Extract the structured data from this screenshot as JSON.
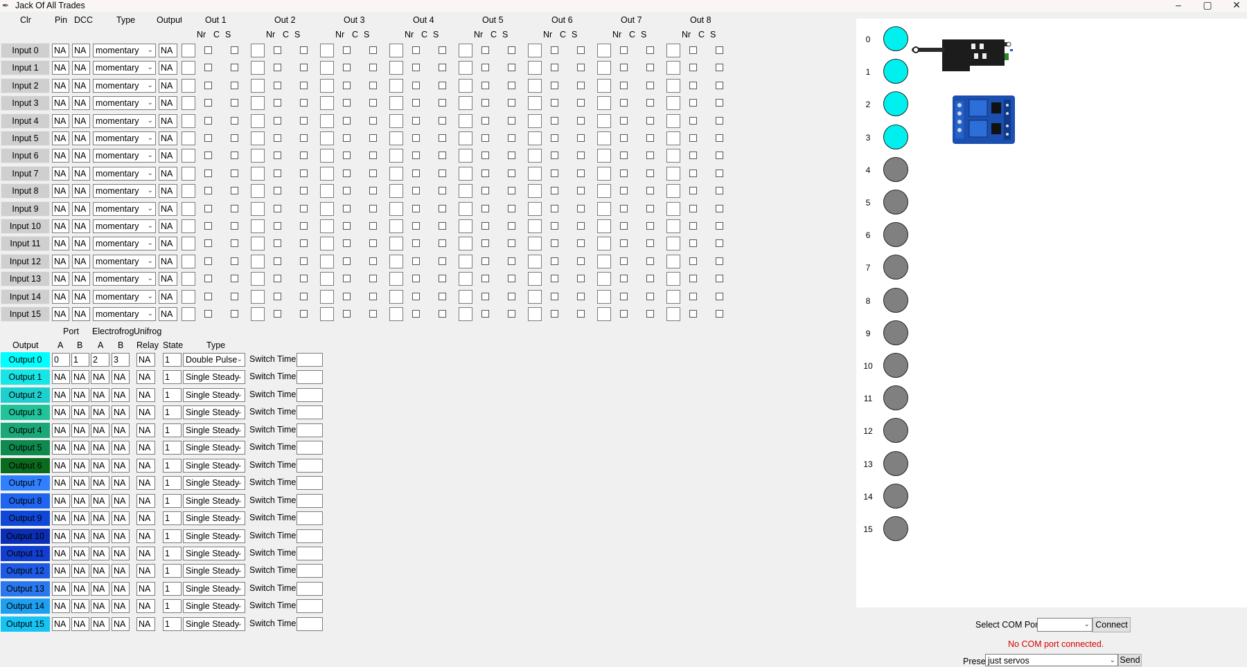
{
  "window": {
    "title": "Jack Of All Trades",
    "icon": "feather-icon",
    "minimize": "–",
    "maximize": "▢",
    "close": "✕"
  },
  "inputs_header": {
    "clr": "Clr",
    "pin": "Pin",
    "dcc": "DCC",
    "type": "Type",
    "output": "Output",
    "outs": [
      "Out 1",
      "Out 2",
      "Out 3",
      "Out 4",
      "Out 5",
      "Out 6",
      "Out 7",
      "Out 8"
    ],
    "sub": [
      "Nr",
      "C",
      "S"
    ]
  },
  "inputs": [
    {
      "label": "Input 0",
      "pin": "NA",
      "dcc": "NA",
      "type": "momentary",
      "output": "NA"
    },
    {
      "label": "Input 1",
      "pin": "NA",
      "dcc": "NA",
      "type": "momentary",
      "output": "NA"
    },
    {
      "label": "Input 2",
      "pin": "NA",
      "dcc": "NA",
      "type": "momentary",
      "output": "NA"
    },
    {
      "label": "Input 3",
      "pin": "NA",
      "dcc": "NA",
      "type": "momentary",
      "output": "NA"
    },
    {
      "label": "Input 4",
      "pin": "NA",
      "dcc": "NA",
      "type": "momentary",
      "output": "NA"
    },
    {
      "label": "Input 5",
      "pin": "NA",
      "dcc": "NA",
      "type": "momentary",
      "output": "NA"
    },
    {
      "label": "Input 6",
      "pin": "NA",
      "dcc": "NA",
      "type": "momentary",
      "output": "NA"
    },
    {
      "label": "Input 7",
      "pin": "NA",
      "dcc": "NA",
      "type": "momentary",
      "output": "NA"
    },
    {
      "label": "Input 8",
      "pin": "NA",
      "dcc": "NA",
      "type": "momentary",
      "output": "NA"
    },
    {
      "label": "Input 9",
      "pin": "NA",
      "dcc": "NA",
      "type": "momentary",
      "output": "NA"
    },
    {
      "label": "Input 10",
      "pin": "NA",
      "dcc": "NA",
      "type": "momentary",
      "output": "NA"
    },
    {
      "label": "Input 11",
      "pin": "NA",
      "dcc": "NA",
      "type": "momentary",
      "output": "NA"
    },
    {
      "label": "Input 12",
      "pin": "NA",
      "dcc": "NA",
      "type": "momentary",
      "output": "NA"
    },
    {
      "label": "Input 13",
      "pin": "NA",
      "dcc": "NA",
      "type": "momentary",
      "output": "NA"
    },
    {
      "label": "Input 14",
      "pin": "NA",
      "dcc": "NA",
      "type": "momentary",
      "output": "NA"
    },
    {
      "label": "Input 15",
      "pin": "NA",
      "dcc": "NA",
      "type": "momentary",
      "output": "NA"
    }
  ],
  "outputs_header": {
    "port": "Port",
    "electrofrog": "Electrofrog",
    "unifrog": "Unifrog",
    "output": "Output",
    "a1": "A",
    "b1": "B",
    "a2": "A",
    "b2": "B",
    "relay": "Relay",
    "state": "State",
    "type": "Type"
  },
  "outputs": [
    {
      "label": "Output 0",
      "color": "#00ffff",
      "text_color": "#000000",
      "pa": "0",
      "pb": "1",
      "ea": "2",
      "eb": "3",
      "relay": "NA",
      "state": "1",
      "type": "Double Pulse",
      "switch_label": "Switch Time",
      "switch_time": ""
    },
    {
      "label": "Output 1",
      "color": "#16e6e6",
      "text_color": "#000000",
      "pa": "NA",
      "pb": "NA",
      "ea": "NA",
      "eb": "NA",
      "relay": "NA",
      "state": "1",
      "type": "Single Steady",
      "switch_label": "Switch Time",
      "switch_time": ""
    },
    {
      "label": "Output 2",
      "color": "#1ecfcf",
      "text_color": "#000000",
      "pa": "NA",
      "pb": "NA",
      "ea": "NA",
      "eb": "NA",
      "relay": "NA",
      "state": "1",
      "type": "Single Steady",
      "switch_label": "Switch Time",
      "switch_time": ""
    },
    {
      "label": "Output 3",
      "color": "#20c39a",
      "text_color": "#000000",
      "pa": "NA",
      "pb": "NA",
      "ea": "NA",
      "eb": "NA",
      "relay": "NA",
      "state": "1",
      "type": "Single Steady",
      "switch_label": "Switch Time",
      "switch_time": ""
    },
    {
      "label": "Output 4",
      "color": "#1aa878",
      "text_color": "#000000",
      "pa": "NA",
      "pb": "NA",
      "ea": "NA",
      "eb": "NA",
      "relay": "NA",
      "state": "1",
      "type": "Single Steady",
      "switch_label": "Switch Time",
      "switch_time": ""
    },
    {
      "label": "Output 5",
      "color": "#0e8a4e",
      "text_color": "#000000",
      "pa": "NA",
      "pb": "NA",
      "ea": "NA",
      "eb": "NA",
      "relay": "NA",
      "state": "1",
      "type": "Single Steady",
      "switch_label": "Switch Time",
      "switch_time": ""
    },
    {
      "label": "Output 6",
      "color": "#0a6a1e",
      "text_color": "#000000",
      "pa": "NA",
      "pb": "NA",
      "ea": "NA",
      "eb": "NA",
      "relay": "NA",
      "state": "1",
      "type": "Single Steady",
      "switch_label": "Switch Time",
      "switch_time": ""
    },
    {
      "label": "Output 7",
      "color": "#2f80ff",
      "text_color": "#000000",
      "pa": "NA",
      "pb": "NA",
      "ea": "NA",
      "eb": "NA",
      "relay": "NA",
      "state": "1",
      "type": "Single Steady",
      "switch_label": "Switch Time",
      "switch_time": ""
    },
    {
      "label": "Output 8",
      "color": "#1e66f2",
      "text_color": "#000000",
      "pa": "NA",
      "pb": "NA",
      "ea": "NA",
      "eb": "NA",
      "relay": "NA",
      "state": "1",
      "type": "Single Steady",
      "switch_label": "Switch Time",
      "switch_time": ""
    },
    {
      "label": "Output 9",
      "color": "#0f48d8",
      "text_color": "#000000",
      "pa": "NA",
      "pb": "NA",
      "ea": "NA",
      "eb": "NA",
      "relay": "NA",
      "state": "1",
      "type": "Single Steady",
      "switch_label": "Switch Time",
      "switch_time": ""
    },
    {
      "label": "Output 10",
      "color": "#0a2eb4",
      "text_color": "#000000",
      "pa": "NA",
      "pb": "NA",
      "ea": "NA",
      "eb": "NA",
      "relay": "NA",
      "state": "1",
      "type": "Single Steady",
      "switch_label": "Switch Time",
      "switch_time": ""
    },
    {
      "label": "Output 11",
      "color": "#123ed0",
      "text_color": "#000000",
      "pa": "NA",
      "pb": "NA",
      "ea": "NA",
      "eb": "NA",
      "relay": "NA",
      "state": "1",
      "type": "Single Steady",
      "switch_label": "Switch Time",
      "switch_time": ""
    },
    {
      "label": "Output 12",
      "color": "#1e5ae6",
      "text_color": "#000000",
      "pa": "NA",
      "pb": "NA",
      "ea": "NA",
      "eb": "NA",
      "relay": "NA",
      "state": "1",
      "type": "Single Steady",
      "switch_label": "Switch Time",
      "switch_time": ""
    },
    {
      "label": "Output 13",
      "color": "#2a78f0",
      "text_color": "#000000",
      "pa": "NA",
      "pb": "NA",
      "ea": "NA",
      "eb": "NA",
      "relay": "NA",
      "state": "1",
      "type": "Single Steady",
      "switch_label": "Switch Time",
      "switch_time": ""
    },
    {
      "label": "Output 14",
      "color": "#1ea0f0",
      "text_color": "#000000",
      "pa": "NA",
      "pb": "NA",
      "ea": "NA",
      "eb": "NA",
      "relay": "NA",
      "state": "1",
      "type": "Single Steady",
      "switch_label": "Switch Time",
      "switch_time": ""
    },
    {
      "label": "Output 15",
      "color": "#16c4f4",
      "text_color": "#000000",
      "pa": "NA",
      "pb": "NA",
      "ea": "NA",
      "eb": "NA",
      "relay": "NA",
      "state": "1",
      "type": "Single Steady",
      "switch_label": "Switch Time",
      "switch_time": ""
    }
  ],
  "indicators": [
    {
      "n": "0",
      "color": "#00f0f0"
    },
    {
      "n": "1",
      "color": "#00f0f0"
    },
    {
      "n": "2",
      "color": "#00f0f0"
    },
    {
      "n": "3",
      "color": "#00f0f0"
    },
    {
      "n": "4",
      "color": "#808080"
    },
    {
      "n": "5",
      "color": "#808080"
    },
    {
      "n": "6",
      "color": "#808080"
    },
    {
      "n": "7",
      "color": "#808080"
    },
    {
      "n": "8",
      "color": "#808080"
    },
    {
      "n": "9",
      "color": "#808080"
    },
    {
      "n": "10",
      "color": "#808080"
    },
    {
      "n": "11",
      "color": "#808080"
    },
    {
      "n": "12",
      "color": "#808080"
    },
    {
      "n": "13",
      "color": "#808080"
    },
    {
      "n": "14",
      "color": "#808080"
    },
    {
      "n": "15",
      "color": "#808080"
    }
  ],
  "images": {
    "turnout_motor": "turnout-motor-image",
    "relay_module": "relay-module-image"
  },
  "com": {
    "select_label": "Select COM Port:",
    "port_value": "",
    "connect": "Connect",
    "status": "No COM port connected.",
    "status_color": "#d40000"
  },
  "preset": {
    "label": "Preset",
    "value": "just servos",
    "send": "Send"
  }
}
